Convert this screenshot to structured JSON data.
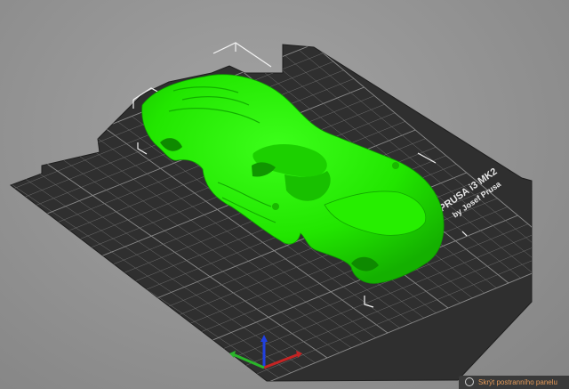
{
  "viewport": {
    "background": "#929292"
  },
  "bed": {
    "label_line1": "PRUSA i3 MK2",
    "label_line2": "by Josef Prusa",
    "plate_color": "#2f2f2f",
    "grid_color": "#6e6e6e"
  },
  "model": {
    "color": "#22e600",
    "shadow_color": "#16a800"
  },
  "axes": {
    "x_color": "#c42424",
    "y_color": "#2ab52a",
    "z_color": "#2040e0"
  },
  "sidebar_toggle": {
    "label": "Skrýt postranního panelu"
  }
}
